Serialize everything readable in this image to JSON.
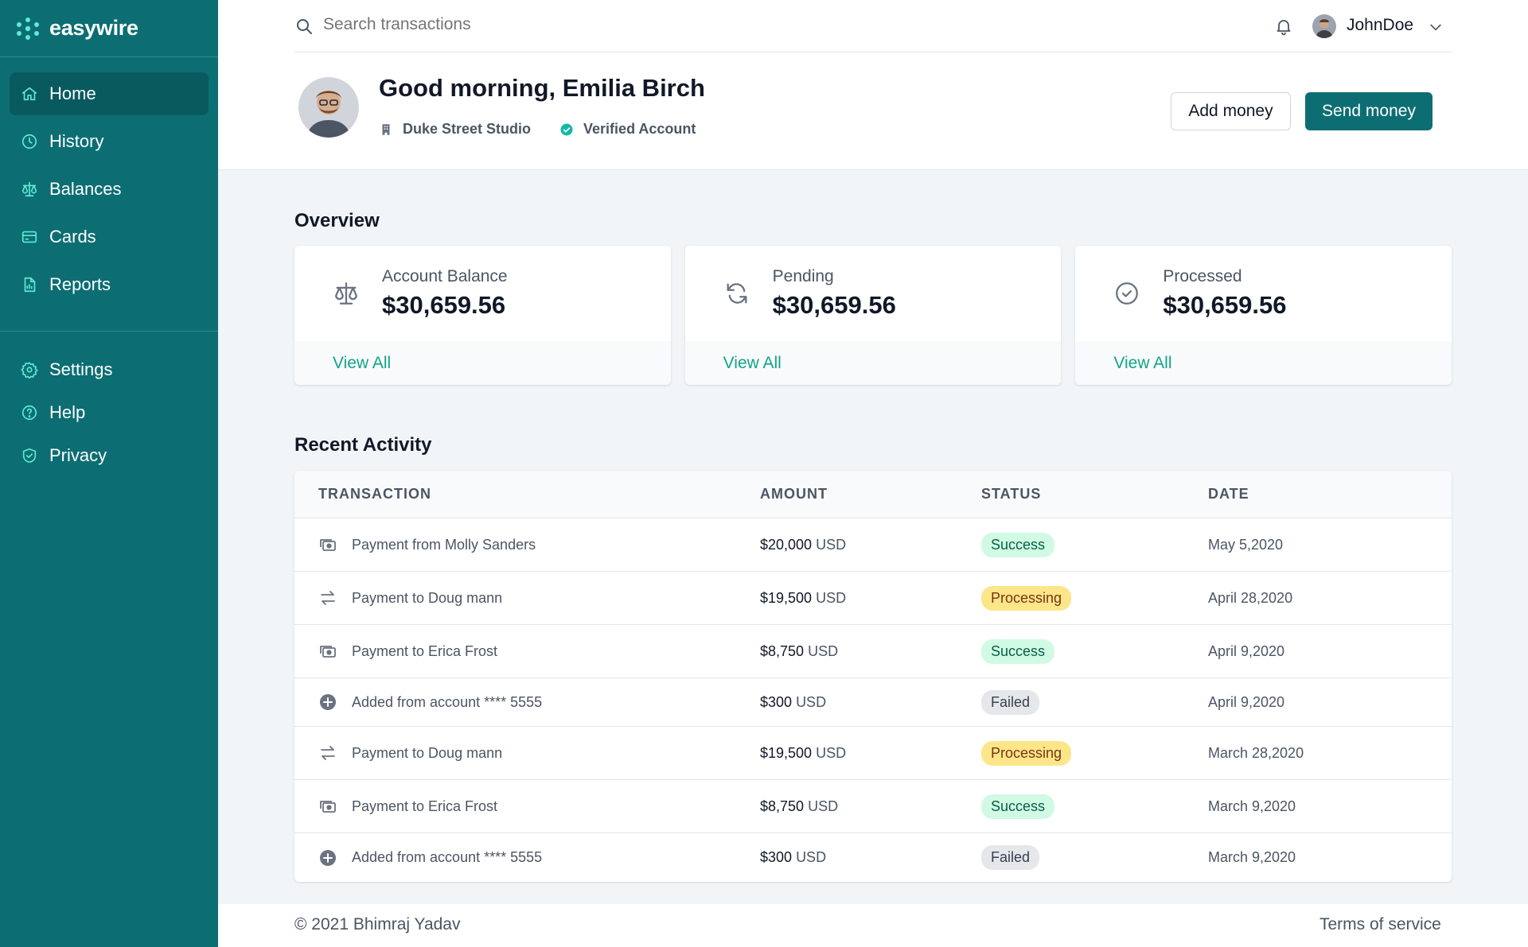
{
  "brand": {
    "name": "easywire",
    "accent": "#0c6e73",
    "link_color": "#14a38b"
  },
  "sidebar": {
    "items": [
      {
        "label": "Home",
        "icon": "home-icon",
        "active": true
      },
      {
        "label": "History",
        "icon": "clock-icon"
      },
      {
        "label": "Balances",
        "icon": "scale-icon"
      },
      {
        "label": "Cards",
        "icon": "credit-card-icon"
      },
      {
        "label": "Reports",
        "icon": "document-report-icon"
      }
    ],
    "secondary": [
      {
        "label": "Settings",
        "icon": "gear-icon"
      },
      {
        "label": "Help",
        "icon": "question-circle-icon"
      },
      {
        "label": "Privacy",
        "icon": "shield-check-icon"
      }
    ]
  },
  "topbar": {
    "search_placeholder": "Search transactions",
    "user_name": "JohnDoe"
  },
  "profile": {
    "greeting": "Good morning, Emilia Birch",
    "company": "Duke Street Studio",
    "verification": "Verified Account",
    "add_money": "Add money",
    "send_money": "Send money"
  },
  "overview": {
    "title": "Overview",
    "cards": [
      {
        "label": "Account Balance",
        "value": "$30,659.56",
        "link": "View All",
        "icon": "scale-icon"
      },
      {
        "label": "Pending",
        "value": "$30,659.56",
        "link": "View All",
        "icon": "refresh-icon"
      },
      {
        "label": "Processed",
        "value": "$30,659.56",
        "link": "View All",
        "icon": "check-circle-icon"
      }
    ]
  },
  "activity": {
    "title": "Recent Activity",
    "columns": [
      "TRANSACTION",
      "AMOUNT",
      "STATUS",
      "DATE"
    ],
    "rows": [
      {
        "transaction": "Payment from Molly Sanders",
        "amount": "$20,000",
        "currency": "USD",
        "status": "Success",
        "date": "May 5,2020",
        "icon": "cash-icon"
      },
      {
        "transaction": "Payment to Doug mann",
        "amount": "$19,500",
        "currency": "USD",
        "status": "Processing",
        "date": "April 28,2020",
        "icon": "switch-horizontal-icon"
      },
      {
        "transaction": "Payment to Erica Frost",
        "amount": "$8,750",
        "currency": "USD",
        "status": "Success",
        "date": "April 9,2020",
        "icon": "cash-icon"
      },
      {
        "transaction": "Added from account **** 5555",
        "amount": "$300",
        "currency": "USD",
        "status": "Failed",
        "date": "April 9,2020",
        "icon": "plus-circle-icon"
      },
      {
        "transaction": "Payment to Doug mann",
        "amount": "$19,500",
        "currency": "USD",
        "status": "Processing",
        "date": "March 28,2020",
        "icon": "switch-horizontal-icon"
      },
      {
        "transaction": "Payment to Erica Frost",
        "amount": "$8,750",
        "currency": "USD",
        "status": "Success",
        "date": "March 9,2020",
        "icon": "cash-icon"
      },
      {
        "transaction": "Added from account **** 5555",
        "amount": "$300",
        "currency": "USD",
        "status": "Failed",
        "date": "March 9,2020",
        "icon": "plus-circle-icon"
      }
    ]
  },
  "footer": {
    "copyright": "© 2021 Bhimraj Yadav",
    "terms": "Terms of service"
  }
}
